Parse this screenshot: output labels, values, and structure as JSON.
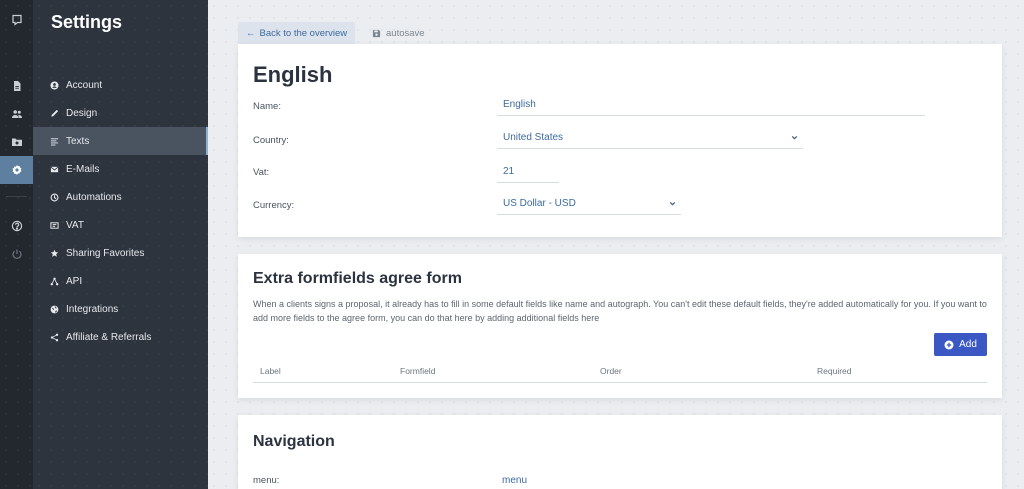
{
  "rail": {
    "icons": [
      "chat-bubble-icon",
      "document-icon",
      "users-icon",
      "folder-icon",
      "gear-icon",
      "help-icon",
      "power-icon"
    ]
  },
  "sidebar": {
    "title": "Settings",
    "items": [
      {
        "label": "Account",
        "icon": "user-circle-icon"
      },
      {
        "label": "Design",
        "icon": "pen-icon"
      },
      {
        "label": "Texts",
        "icon": "text-lines-icon"
      },
      {
        "label": "E-Mails",
        "icon": "envelope-icon"
      },
      {
        "label": "Automations",
        "icon": "automation-icon"
      },
      {
        "label": "VAT",
        "icon": "receipt-icon"
      },
      {
        "label": "Sharing Favorites",
        "icon": "star-icon"
      },
      {
        "label": "API",
        "icon": "network-icon"
      },
      {
        "label": "Integrations",
        "icon": "globe-icon"
      },
      {
        "label": "Affiliate & Referrals",
        "icon": "share-icon"
      }
    ]
  },
  "toolbar": {
    "back_label": "Back to the overview",
    "autosave_label": "autosave"
  },
  "language_card": {
    "title": "English",
    "fields": {
      "name": {
        "label": "Name:",
        "value": "English"
      },
      "country": {
        "label": "Country:",
        "value": "United States"
      },
      "vat": {
        "label": "Vat:",
        "value": "21"
      },
      "currency": {
        "label": "Currency:",
        "value": "US Dollar - USD"
      }
    }
  },
  "formfields_card": {
    "title": "Extra formfields agree form",
    "description": "When a clients signs a proposal, it already has to fill in some default fields like name and autograph. You can't edit these default fields, they're added automatically for you. If you want to add more fields to the agree form, you can do that here by adding additional fields here",
    "add_label": "Add",
    "columns": [
      "Label",
      "Formfield",
      "Order",
      "Required"
    ]
  },
  "navigation_card": {
    "title": "Navigation",
    "menu_label": "menu:",
    "menu_value": "menu"
  },
  "colors": {
    "rail_bg": "#23282f",
    "sidebar_bg": "#2e343d",
    "accent": "#3a57c3",
    "link": "#3d6b9e",
    "active_rail": "#5f7fa0"
  }
}
